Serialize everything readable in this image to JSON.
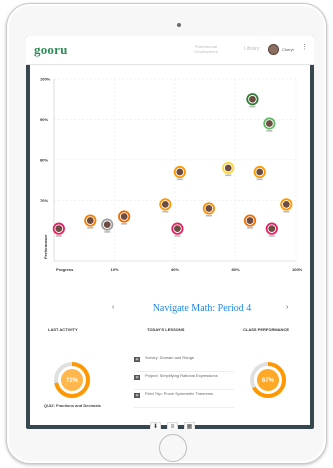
{
  "header": {
    "logo": "gooru",
    "nav_pd": "Professional Development",
    "nav_library": "Library",
    "user_name": "Cheryl"
  },
  "chart_data": {
    "type": "scatter",
    "title": "",
    "xlabel": "Progress",
    "ylabel": "Performance",
    "x_ticks": [
      "10%",
      "40%",
      "80%",
      "100%"
    ],
    "y_ticks": [
      "100%",
      "90%",
      "80%",
      "70%"
    ],
    "grid": true,
    "points": [
      {
        "x": 2,
        "y": 63,
        "color": "#e91e63"
      },
      {
        "x": 15,
        "y": 65,
        "color": "#f57c00"
      },
      {
        "x": 22,
        "y": 64,
        "color": "#9e9e9e"
      },
      {
        "x": 29,
        "y": 66,
        "color": "#ef6c00"
      },
      {
        "x": 46,
        "y": 69,
        "color": "#ff9800"
      },
      {
        "x": 51,
        "y": 63,
        "color": "#e91e63"
      },
      {
        "x": 52,
        "y": 77,
        "color": "#ff9800"
      },
      {
        "x": 64,
        "y": 68,
        "color": "#fb8c00"
      },
      {
        "x": 72,
        "y": 78,
        "color": "#fdd835"
      },
      {
        "x": 81,
        "y": 65,
        "color": "#ef6c00"
      },
      {
        "x": 85,
        "y": 77,
        "color": "#ff9800"
      },
      {
        "x": 82,
        "y": 95,
        "color": "#2e7d32"
      },
      {
        "x": 89,
        "y": 89,
        "color": "#66bb6a"
      },
      {
        "x": 90,
        "y": 63,
        "color": "#e91e63"
      },
      {
        "x": 96,
        "y": 69,
        "color": "#ff9800"
      }
    ]
  },
  "class_nav": {
    "prev": "‹",
    "title": "Navigate Math: Period 4",
    "next": "›"
  },
  "sections": {
    "last_activity": "LAST ACTIVITY",
    "todays_lessons": "TODAY'S LESSONS",
    "class_performance": "CLASS PERFORMANCE"
  },
  "last_activity": {
    "score": "72%",
    "score_value": 72,
    "label": "QUIZ: Fractions and Decimals",
    "color": "#ffa726"
  },
  "lessons": [
    {
      "text": "Survey: Domain and Range"
    },
    {
      "text": "Project: Simplifying Rational Expressions"
    },
    {
      "text": "Field Trip: Prove Symmetric Theorems"
    }
  ],
  "class_performance": {
    "score": "67%",
    "score_value": 67,
    "color": "#ffa726"
  },
  "icons": {
    "toolbar": [
      "download-icon",
      "filter-icon",
      "grid-icon"
    ]
  }
}
